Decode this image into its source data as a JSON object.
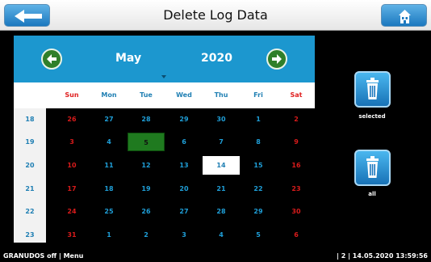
{
  "window": {
    "title": "Delete Log Data",
    "back_icon": "arrow-left-icon",
    "home_icon": "home-icon"
  },
  "calendar": {
    "month": "May",
    "year": "2020",
    "prev_icon": "arrow-circle-left-icon",
    "next_icon": "arrow-circle-right-icon",
    "weekdays": [
      "Sun",
      "Mon",
      "Tue",
      "Wed",
      "Thu",
      "Fri",
      "Sat"
    ],
    "week_numbers": [
      "18",
      "19",
      "20",
      "21",
      "22",
      "23"
    ],
    "days": [
      [
        "26",
        "27",
        "28",
        "29",
        "30",
        "1",
        "2"
      ],
      [
        "3",
        "4",
        "5",
        "6",
        "7",
        "8",
        "9"
      ],
      [
        "10",
        "11",
        "12",
        "13",
        "14",
        "15",
        "16"
      ],
      [
        "17",
        "18",
        "19",
        "20",
        "21",
        "22",
        "23"
      ],
      [
        "24",
        "25",
        "26",
        "27",
        "28",
        "29",
        "30"
      ],
      [
        "31",
        "1",
        "2",
        "3",
        "4",
        "5",
        "6"
      ]
    ],
    "selected_day": "5",
    "today_day": "14",
    "colors": {
      "header": "#1c97cf",
      "weekday": "#1f7fb3",
      "weekend": "#d81b1b",
      "selected": "#1f7a1f",
      "today": "#ffffff"
    }
  },
  "actions": {
    "selected_label": "selected",
    "all_label": "all",
    "trash_icon": "trash-can-icon"
  },
  "status": {
    "left": "GRANUDOS off | Menu",
    "right": "| 2 | 14.05.2020 13:59:56"
  }
}
